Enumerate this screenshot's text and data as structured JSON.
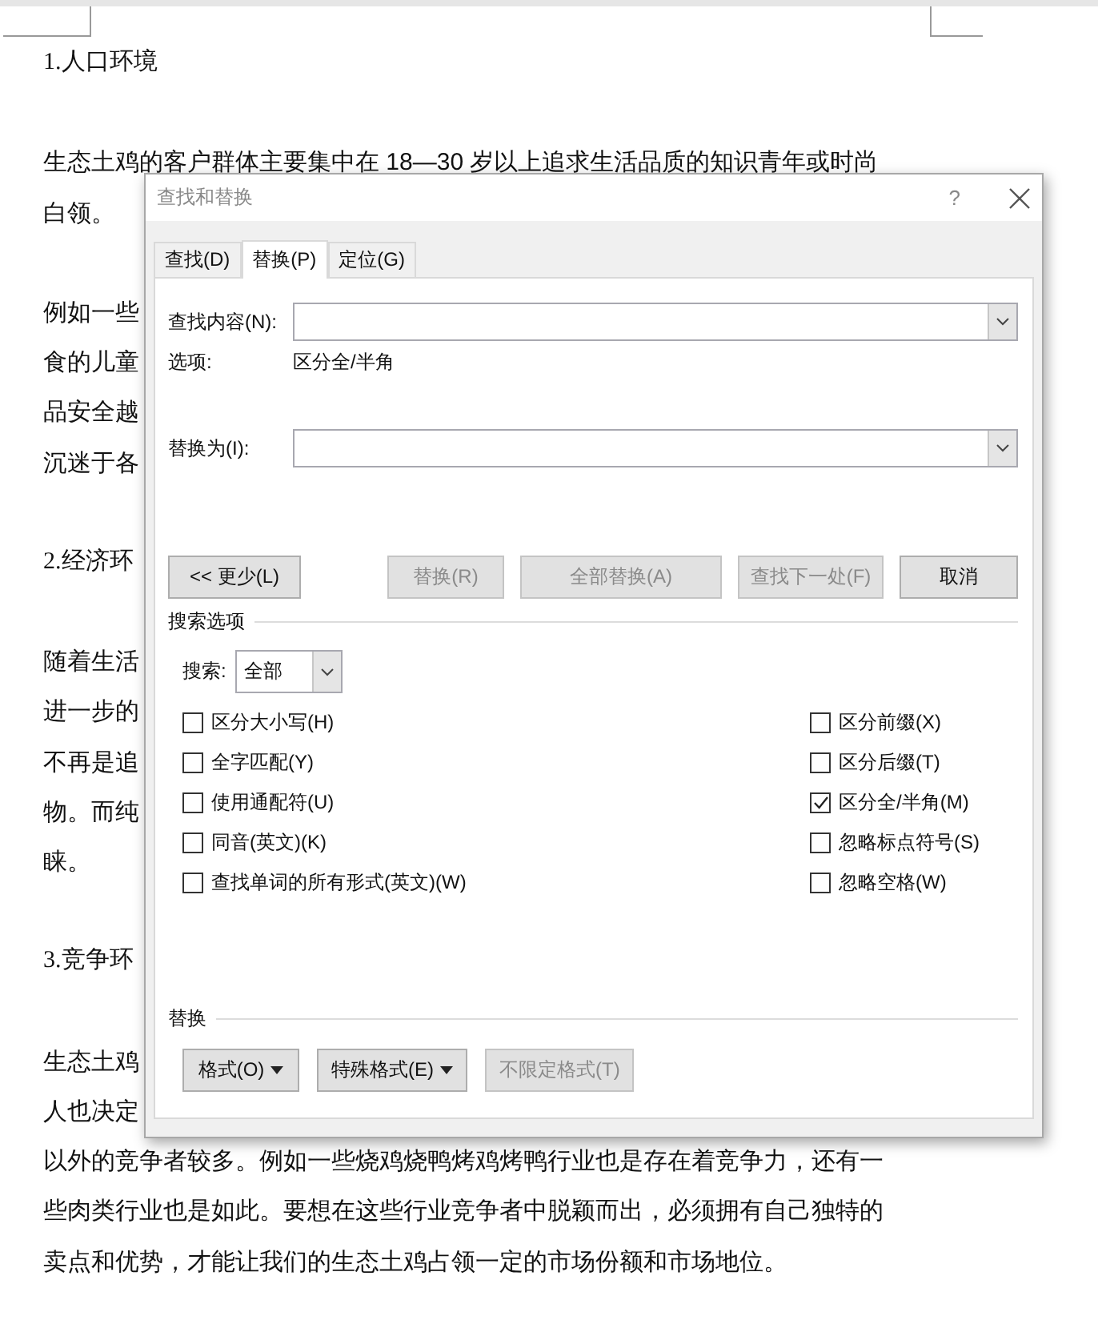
{
  "document": {
    "blocks": [
      {
        "kind": "heading",
        "lines": [
          "1.人口环境"
        ]
      },
      {
        "kind": "para",
        "lines": [
          "生态土鸡的客户群体主要集中在 18—30 岁以上追求生活品质的知识青年或时尚",
          "白领。"
        ]
      },
      {
        "kind": "para",
        "lines": [
          "例如一些",
          "食的儿童",
          "品安全越",
          "沉迷于各"
        ]
      },
      {
        "kind": "heading",
        "lines": [
          "2.经济环"
        ]
      },
      {
        "kind": "para",
        "lines": [
          "随着生活",
          "进一步的",
          "不再是追",
          "物。而纯",
          "睐。"
        ]
      },
      {
        "kind": "heading",
        "lines": [
          "3.竞争环"
        ]
      },
      {
        "kind": "para",
        "lines": [
          "生态土鸡",
          "人也决定",
          "以外的竞争者较多。例如一些烧鸡烧鸭烤鸡烤鸭行业也是存在着竞争力，还有一",
          "些肉类行业也是如此。要想在这些行业竞争者中脱颖而出，必须拥有自己独特的",
          "卖点和优势，才能让我们的生态土鸡占领一定的市场份额和市场地位。"
        ]
      }
    ]
  },
  "dialog": {
    "title": "查找和替换",
    "help": "?",
    "tabs": [
      {
        "label": "查找(D)",
        "selected": false
      },
      {
        "label": "替换(P)",
        "selected": true
      },
      {
        "label": "定位(G)",
        "selected": false
      }
    ],
    "find_label": "查找内容(N):",
    "options_label": "选项:",
    "options_value": "区分全/半角",
    "replace_label": "替换为(I):",
    "buttons": [
      {
        "label": "<< 更少(L)",
        "disabled": false
      },
      {
        "label": "替换(R)",
        "disabled": true
      },
      {
        "label": "全部替换(A)",
        "disabled": true
      },
      {
        "label": "查找下一处(F)",
        "disabled": true
      },
      {
        "label": "取消",
        "disabled": false
      }
    ],
    "search_options_title": "搜索选项",
    "search_label": "搜索:",
    "search_value": "全部",
    "checkboxes_left": [
      {
        "label": "区分大小写(H)",
        "checked": false
      },
      {
        "label": "全字匹配(Y)",
        "checked": false
      },
      {
        "label": "使用通配符(U)",
        "checked": false
      },
      {
        "label": "同音(英文)(K)",
        "checked": false
      },
      {
        "label": "查找单词的所有形式(英文)(W)",
        "checked": false
      }
    ],
    "checkboxes_right": [
      {
        "label": "区分前缀(X)",
        "checked": false
      },
      {
        "label": "区分后缀(T)",
        "checked": false
      },
      {
        "label": "区分全/半角(M)",
        "checked": true
      },
      {
        "label": "忽略标点符号(S)",
        "checked": false
      },
      {
        "label": "忽略空格(W)",
        "checked": false
      }
    ],
    "replace_section_title": "替换",
    "format_buttons": [
      {
        "label": "格式(O)",
        "menu": true,
        "disabled": false
      },
      {
        "label": "特殊格式(E)",
        "menu": true,
        "disabled": false
      },
      {
        "label": "不限定格式(T)",
        "menu": false,
        "disabled": true
      }
    ]
  }
}
